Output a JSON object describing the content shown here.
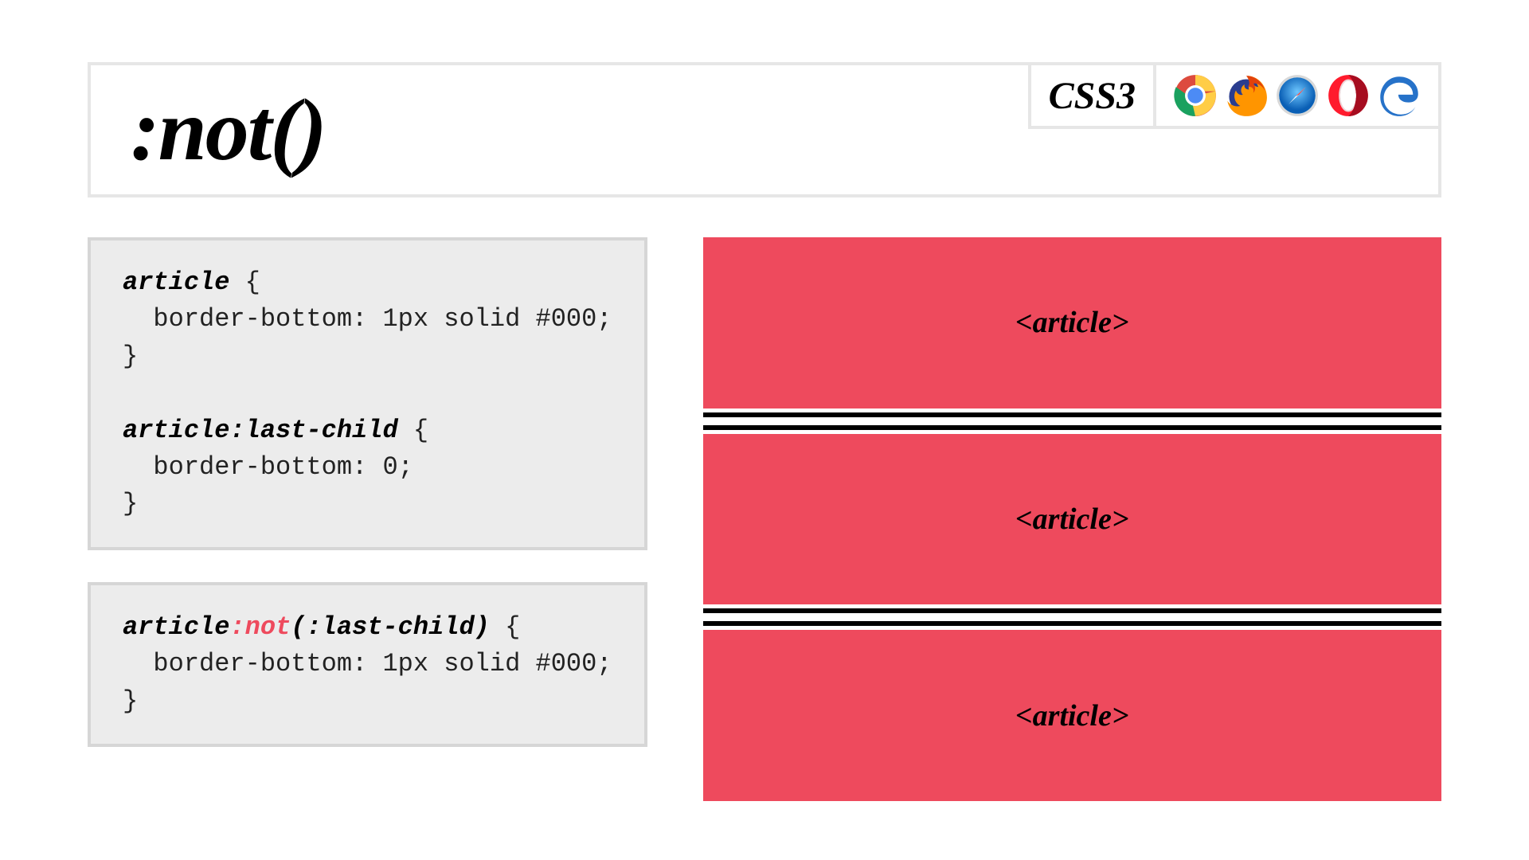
{
  "header": {
    "title": ":not()",
    "badge": "CSS3",
    "browsers": [
      "chrome-icon",
      "firefox-icon",
      "safari-icon",
      "opera-icon",
      "edge-icon"
    ]
  },
  "code": {
    "block1": {
      "sel1": "article",
      "brace_open": " {",
      "rule1": "  border-bottom: 1px solid #000;",
      "brace_close1": "}",
      "blank": "",
      "sel2": "article:last-child",
      "brace_open2": " {",
      "rule2": "  border-bottom: 0;",
      "brace_close2": "}"
    },
    "block2": {
      "sel_a": "article",
      "sel_hot": ":not",
      "sel_b": "(:last-child)",
      "brace_open": " {",
      "rule": "  border-bottom: 1px solid #000;",
      "brace_close": "}"
    }
  },
  "preview": {
    "article_label": "<article>"
  },
  "colors": {
    "accent": "#ee4a5d",
    "panel": "#ececec",
    "panel_border": "#d6d6d6",
    "header_border": "#e6e6e6"
  }
}
